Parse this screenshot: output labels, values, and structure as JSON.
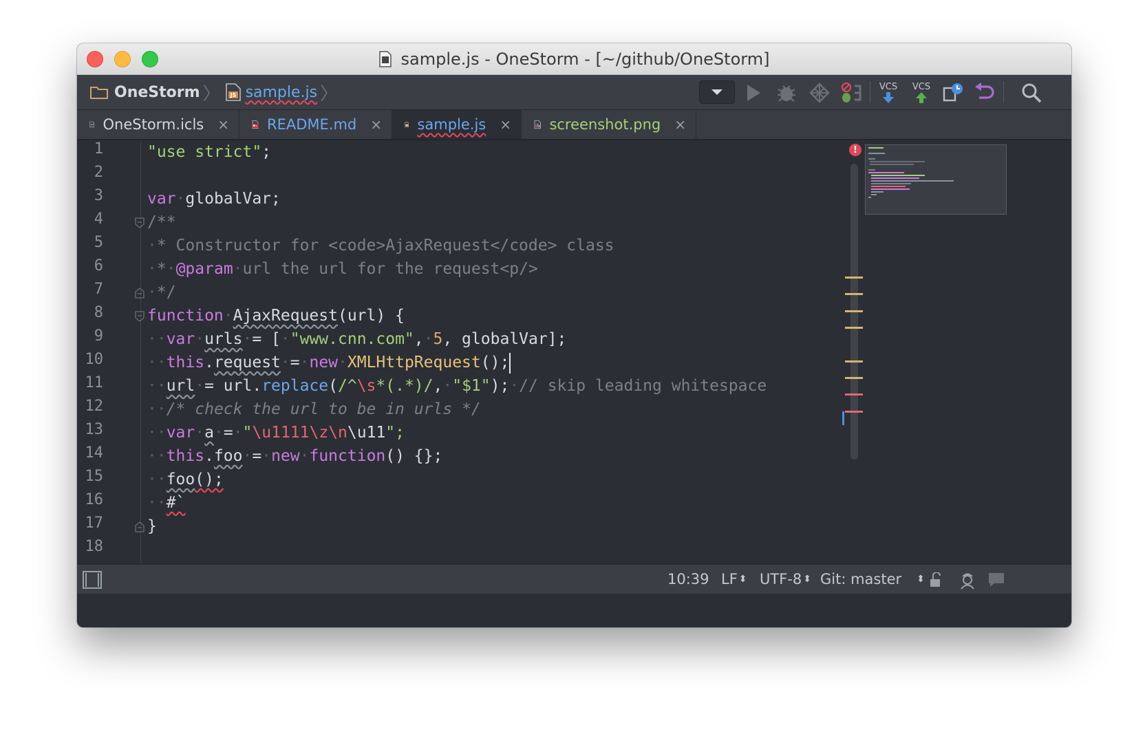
{
  "window": {
    "title": "sample.js - OneStorm - [~/github/OneStorm]"
  },
  "navbar": {
    "project": "OneStorm",
    "file": "sample.js",
    "toolbar_icons": [
      "dropdown-icon",
      "run-icon",
      "debug-icon",
      "coverage-icon",
      "stop-icon",
      "vcs-update-icon",
      "vcs-commit-icon",
      "history-icon",
      "revert-icon",
      "search-icon"
    ],
    "vcs_label": "VCS"
  },
  "tabs": [
    {
      "label": "OneStorm.icls",
      "icon": "icls-file-icon"
    },
    {
      "label": "README.md",
      "icon": "markdown-file-icon"
    },
    {
      "label": "sample.js",
      "icon": "js-file-icon",
      "active": true
    },
    {
      "label": "screenshot.png",
      "icon": "image-file-icon"
    }
  ],
  "tab_close": "×",
  "editor": {
    "line_numbers": [
      "1",
      "2",
      "3",
      "4",
      "5",
      "6",
      "7",
      "8",
      "9",
      "10",
      "11",
      "12",
      "13",
      "14",
      "15",
      "16",
      "17",
      "18"
    ],
    "error_badge": "!"
  },
  "code": {
    "l1": {
      "str": "\"use strict\"",
      "punct": ";"
    },
    "l3": {
      "kw": "var",
      "rest": "globalVar;"
    },
    "l4": {
      "cm": "/**"
    },
    "l5": {
      "cm": "* Constructor for <code>AjaxRequest</code> class"
    },
    "l6": {
      "cm_a": "*",
      "tag": "@param",
      "cm_b": "url the url for the request<p/>"
    },
    "l7": {
      "cm": "*/"
    },
    "l8": {
      "kw": "function",
      "name": "AjaxRequest",
      "rest": "(url) {"
    },
    "l9": {
      "kw": "var",
      "name": "urls",
      "eq": "= [",
      "s1": "\"www.cnn.com\"",
      "c1": ",",
      "n": "5",
      "c2": ", globalVar];"
    },
    "l10": {
      "kw": "this",
      "dot": ".",
      "prop": "request",
      "eq": "=",
      "kw2": "new",
      "cls": "XMLHttpRequest",
      "rest": "();"
    },
    "l11": {
      "var": "url",
      "eq": "= url.",
      "method": "replace",
      "open": "(",
      "re_a": "/^",
      "re_esc": "\\s",
      "re_b": "*(.*)/",
      "c": ",",
      "s": "\"$1\"",
      "close": ");",
      "cm": "// skip leading whitespace"
    },
    "l12": {
      "cm": "/* check the url to be in urls */"
    },
    "l13": {
      "kw": "var",
      "name": "a",
      "eq": "=",
      "q1": "\"",
      "e1": "\\u1111\\z\\n",
      "e2": "\\u11",
      "q2": "\";"
    },
    "l14": {
      "kw": "this",
      "dot": ".",
      "prop": "foo",
      "eq": "=",
      "kw2": "new",
      "kw3": "function",
      "rest": "() {};"
    },
    "l15": {
      "name": "foo",
      "rest": "();"
    },
    "l16": {
      "txt": "#`"
    },
    "l17": {
      "txt": "}"
    }
  },
  "status": {
    "position": "10:39",
    "line_sep": "LF",
    "encoding": "UTF-8",
    "vcs_branch": "Git: master",
    "arrows": "⬍"
  },
  "colors": {
    "keyword": "#c97be0",
    "string": "#a4d07a",
    "number": "#e5a55f",
    "comment": "#7b808a",
    "class": "#e8c07a",
    "method": "#6aa7ef",
    "escape": "#e7646f",
    "background": "#2b2e34"
  }
}
